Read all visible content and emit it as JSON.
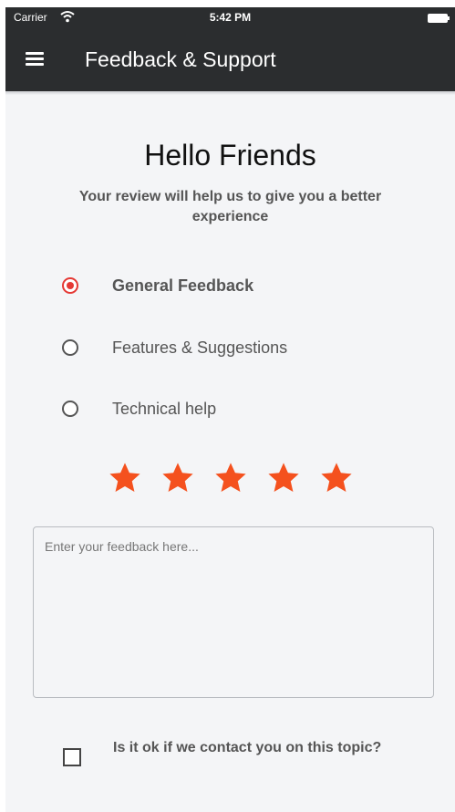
{
  "status_bar": {
    "carrier": "Carrier",
    "time": "5:42 PM"
  },
  "nav": {
    "title": "Feedback & Support",
    "menu_icon": "hamburger-menu-icon"
  },
  "content": {
    "greeting": "Hello Friends",
    "subtitle": "Your review will help us to give you a better experience"
  },
  "options": [
    {
      "label": "General Feedback",
      "selected": true
    },
    {
      "label": "Features & Suggestions",
      "selected": false
    },
    {
      "label": "Technical help",
      "selected": false
    }
  ],
  "rating": {
    "value": 5,
    "max": 5,
    "color": "#f4511e"
  },
  "feedback": {
    "placeholder": "Enter your feedback here...",
    "value": ""
  },
  "contact": {
    "label": "Is it ok if we contact you on this topic?",
    "checked": false
  },
  "colors": {
    "header": "#2b2d2f",
    "background": "#f4f5f7",
    "radio_selected": "#e53935"
  }
}
